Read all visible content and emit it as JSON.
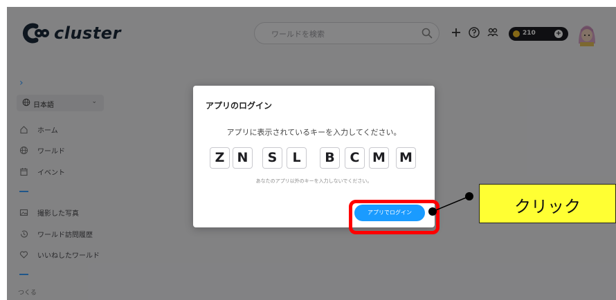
{
  "header": {
    "logo_text": "cluster",
    "search_placeholder": "ワールドを検索",
    "coins": "210",
    "coin_add": "+"
  },
  "sidebar": {
    "toggle": "›",
    "language": "日本語",
    "items": [
      {
        "label": "ホーム",
        "icon": "home-icon"
      },
      {
        "label": "ワールド",
        "icon": "globe-icon"
      },
      {
        "label": "イベント",
        "icon": "calendar-icon"
      },
      {
        "label": "撮影した写真",
        "icon": "photo-icon"
      },
      {
        "label": "ワールド訪問履歴",
        "icon": "history-icon"
      },
      {
        "label": "いいねしたワールド",
        "icon": "heart-icon"
      }
    ],
    "section_create": "つくる"
  },
  "modal": {
    "title": "アプリのログイン",
    "instruction": "アプリに表示されているキーを入力してください。",
    "keys": [
      "Z",
      "N",
      "S",
      "L",
      "B",
      "C",
      "M",
      "M"
    ],
    "note": "あなたのアプリ以外のキーを入力しないでください。",
    "login_button": "アプリでログイン"
  },
  "annotation": {
    "callout": "クリック",
    "highlight_color": "#ff0000",
    "callout_color": "#ffff33"
  },
  "colors": {
    "accent": "#1a9bff",
    "sidebar_accent": "#3aa0ff"
  }
}
